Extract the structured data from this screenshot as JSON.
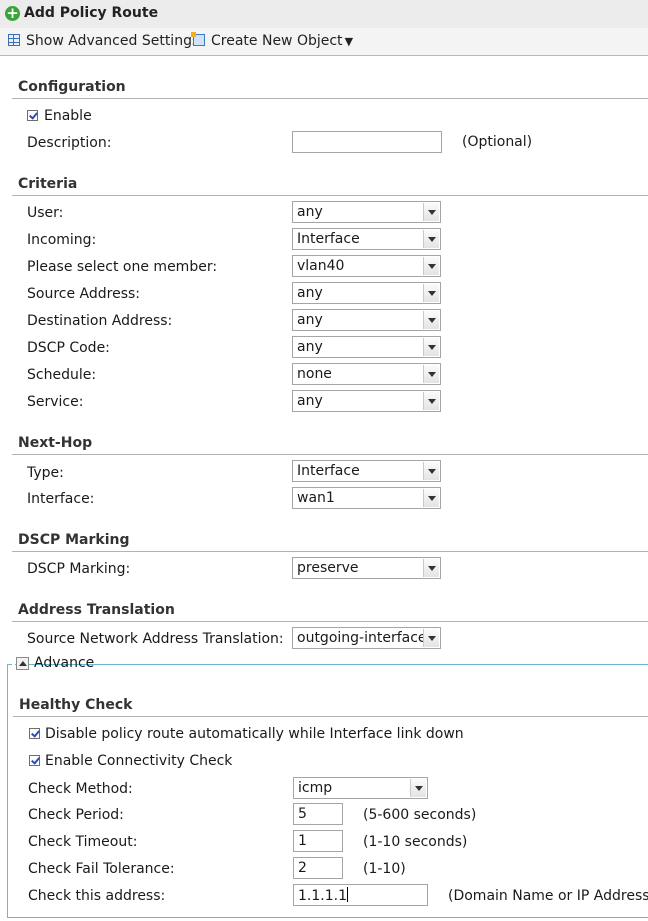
{
  "window": {
    "title": "Add Policy Route"
  },
  "toolbar": {
    "advanced": "Show Advanced Settings",
    "create": "Create New Object"
  },
  "configuration": {
    "heading": "Configuration",
    "enable_label": "Enable",
    "enable_checked": true,
    "description_label": "Description:",
    "description_value": "",
    "optional_hint": "(Optional)"
  },
  "criteria": {
    "heading": "Criteria",
    "rows": [
      {
        "label": "User:",
        "value": "any"
      },
      {
        "label": "Incoming:",
        "value": "Interface"
      },
      {
        "label": "Please select one member:",
        "value": "vlan40"
      },
      {
        "label": "Source Address:",
        "value": "any"
      },
      {
        "label": "Destination Address:",
        "value": "any"
      },
      {
        "label": "DSCP Code:",
        "value": "any"
      },
      {
        "label": "Schedule:",
        "value": "none"
      },
      {
        "label": "Service:",
        "value": "any"
      }
    ]
  },
  "nexthop": {
    "heading": "Next-Hop",
    "rows": [
      {
        "label": "Type:",
        "value": "Interface"
      },
      {
        "label": "Interface:",
        "value": "wan1"
      }
    ]
  },
  "dscp": {
    "heading": "DSCP Marking",
    "label": "DSCP Marking:",
    "value": "preserve"
  },
  "translation": {
    "heading": "Address Translation",
    "label": "Source Network Address Translation:",
    "value": "outgoing-interface"
  },
  "advance": {
    "toggle_label": "Advance",
    "heading": "Healthy Check",
    "disable_label": "Disable policy route automatically while Interface link down",
    "disable_checked": true,
    "connectivity_label": "Enable Connectivity Check",
    "connectivity_checked": true,
    "method_label": "Check Method:",
    "method_value": "icmp",
    "period_label": "Check Period:",
    "period_value": "5",
    "period_hint": "(5-600 seconds)",
    "timeout_label": "Check Timeout:",
    "timeout_value": "1",
    "timeout_hint": "(1-10 seconds)",
    "tolerance_label": "Check Fail Tolerance:",
    "tolerance_value": "2",
    "tolerance_hint": "(1-10)",
    "address_label": "Check this address:",
    "address_value": "1.1.1.1",
    "address_hint": "(Domain Name or IP Address)"
  }
}
